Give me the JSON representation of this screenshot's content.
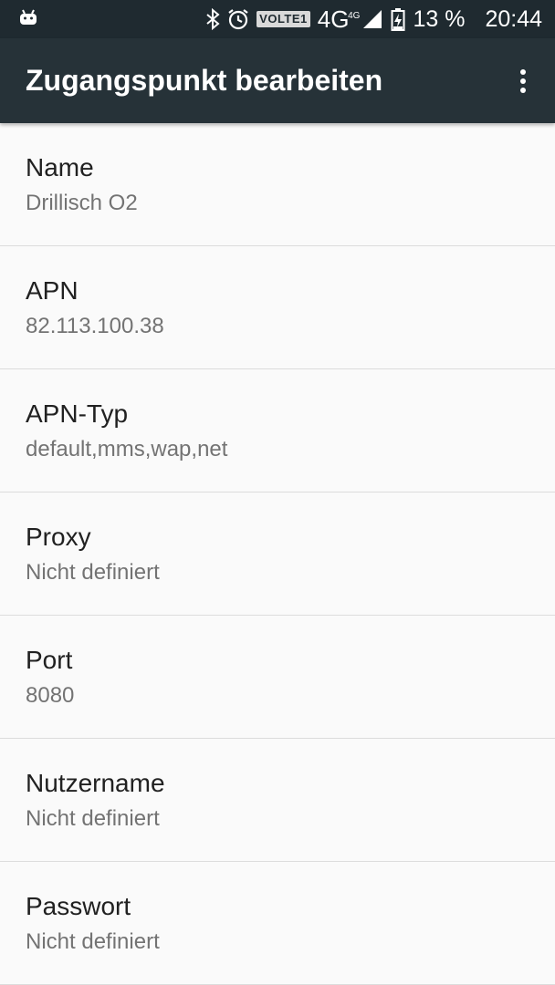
{
  "status_bar": {
    "volte_label": "VOLTE1",
    "network": "4G",
    "network_sup": "4G",
    "battery_percent": "13 %",
    "time": "20:44"
  },
  "toolbar": {
    "title": "Zugangspunkt bearbeiten"
  },
  "preferences": [
    {
      "title": "Name",
      "summary": "Drillisch O2"
    },
    {
      "title": "APN",
      "summary": "82.113.100.38"
    },
    {
      "title": "APN-Typ",
      "summary": "default,mms,wap,net"
    },
    {
      "title": "Proxy",
      "summary": "Nicht definiert"
    },
    {
      "title": "Port",
      "summary": "8080"
    },
    {
      "title": "Nutzername",
      "summary": "Nicht definiert"
    },
    {
      "title": "Passwort",
      "summary": "Nicht definiert"
    }
  ],
  "colors": {
    "status_bar": "#1f2a30",
    "toolbar": "#263238",
    "background": "#fafafa"
  }
}
